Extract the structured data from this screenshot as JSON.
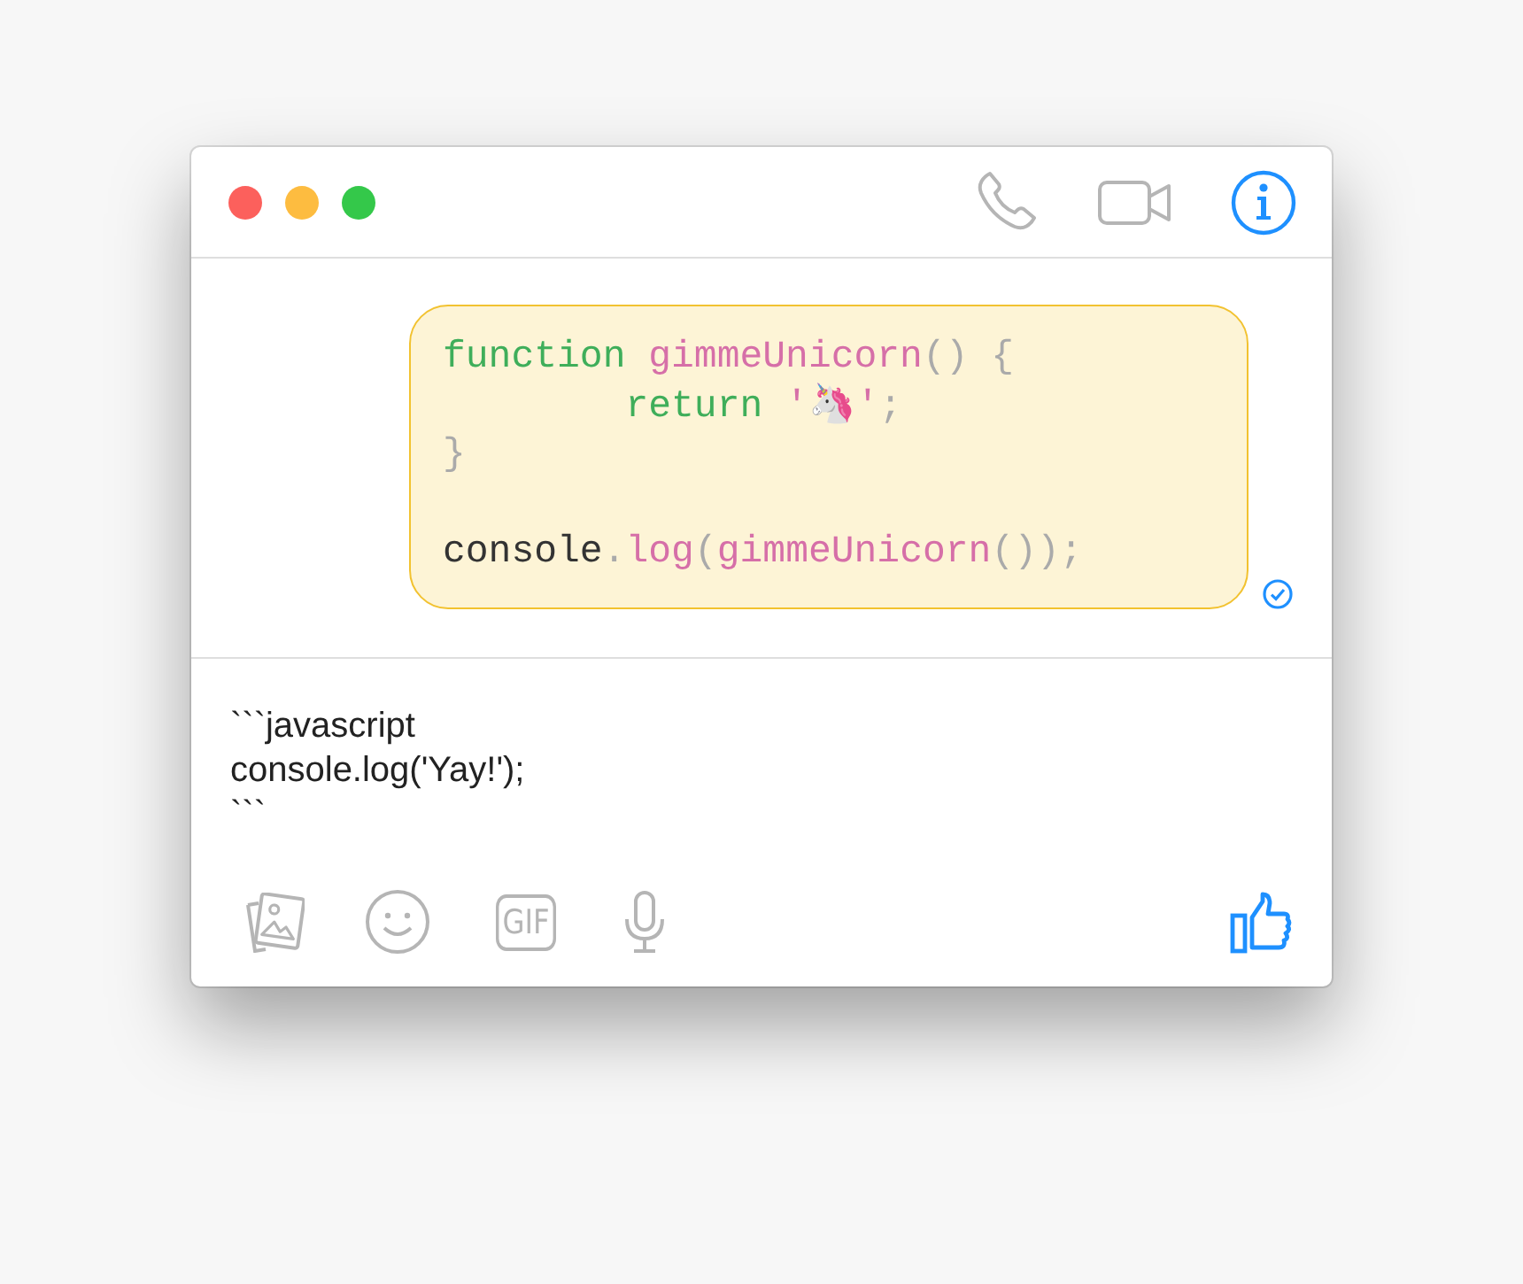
{
  "window": {
    "controls": [
      {
        "color": "#fc605c"
      },
      {
        "color": "#fdbc40"
      },
      {
        "color": "#34c84a"
      }
    ]
  },
  "message": {
    "code": [
      {
        "kind": "code",
        "tokens": [
          {
            "kind": "keyword",
            "text": "function "
          },
          {
            "kind": "name",
            "text": "gimmeUnicorn"
          },
          {
            "kind": "punct",
            "text": "() {"
          }
        ]
      },
      {
        "kind": "code",
        "tokens": [
          {
            "kind": "keyword",
            "text": "        return "
          },
          {
            "kind": "name",
            "text": "'🦄'"
          },
          {
            "kind": "punct",
            "text": ";"
          }
        ]
      },
      {
        "kind": "code",
        "tokens": [
          {
            "kind": "punct",
            "text": "}"
          }
        ]
      },
      {
        "kind": "blank"
      },
      {
        "kind": "code",
        "tokens": [
          {
            "kind": "plain",
            "text": "console"
          },
          {
            "kind": "punct",
            "text": "."
          },
          {
            "kind": "name",
            "text": "log"
          },
          {
            "kind": "punct",
            "text": "("
          },
          {
            "kind": "name",
            "text": "gimmeUnicorn"
          },
          {
            "kind": "punct",
            "text": "());"
          }
        ]
      }
    ],
    "delivered": true
  },
  "composer": {
    "lines": [
      "```javascript",
      "console.log('Yay!');",
      "```"
    ]
  },
  "toolbar": {
    "gif_label": "GIF"
  }
}
